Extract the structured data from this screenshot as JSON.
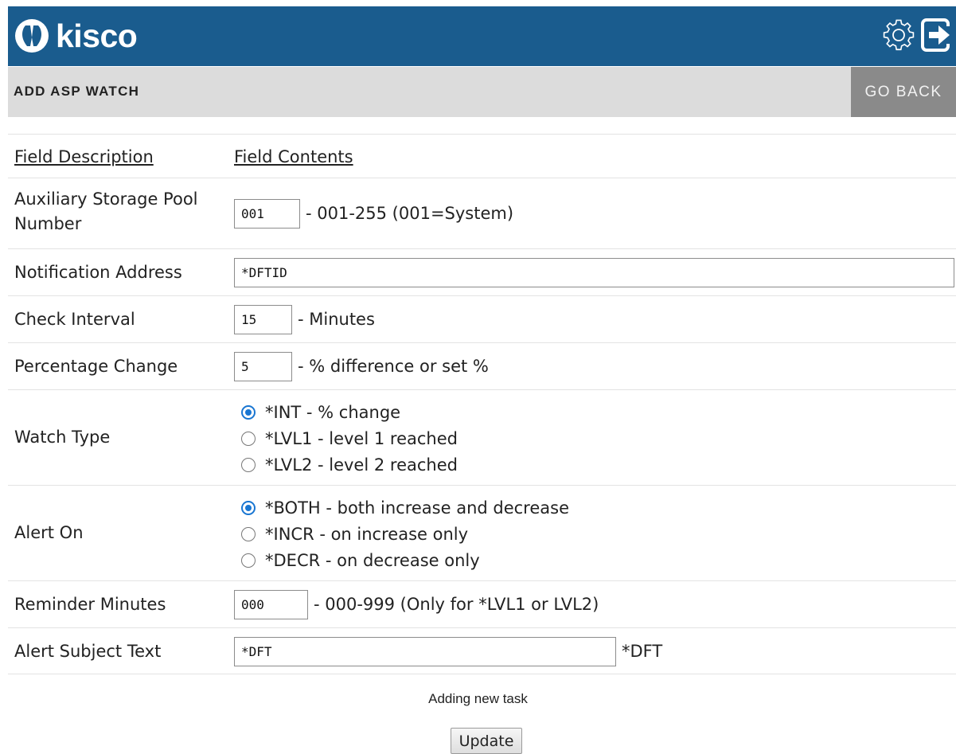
{
  "header": {
    "brand": "kisco",
    "icons": [
      "gear-icon",
      "logout-icon"
    ],
    "brand_color": "#1a5c8e"
  },
  "subheader": {
    "title": "ADD ASP WATCH",
    "back_label": "GO BACK"
  },
  "table": {
    "col_description": "Field Description",
    "col_contents": "Field Contents"
  },
  "fields": {
    "asp_number": {
      "label": "Auxiliary Storage Pool Number",
      "value": "001",
      "hint": "- 001-255 (001=System)"
    },
    "notification_address": {
      "label": "Notification Address",
      "value": "*DFTID"
    },
    "check_interval": {
      "label": "Check Interval",
      "value": "15",
      "hint": "- Minutes"
    },
    "percentage_change": {
      "label": "Percentage Change",
      "value": "5",
      "hint": "- % difference or set %"
    },
    "watch_type": {
      "label": "Watch Type",
      "options": [
        {
          "label": "*INT - % change",
          "selected": true
        },
        {
          "label": "*LVL1 - level 1 reached",
          "selected": false
        },
        {
          "label": "*LVL2 - level 2 reached",
          "selected": false
        }
      ]
    },
    "alert_on": {
      "label": "Alert On",
      "options": [
        {
          "label": "*BOTH - both increase and decrease",
          "selected": true
        },
        {
          "label": "*INCR - on increase only",
          "selected": false
        },
        {
          "label": "*DECR - on decrease only",
          "selected": false
        }
      ]
    },
    "reminder_minutes": {
      "label": "Reminder Minutes",
      "value": "000",
      "hint": "- 000-999 (Only for *LVL1 or LVL2)"
    },
    "alert_subject": {
      "label": "Alert Subject Text",
      "value": "*DFT",
      "hint": "*DFT"
    }
  },
  "status": "Adding new task",
  "submit_label": "Update"
}
